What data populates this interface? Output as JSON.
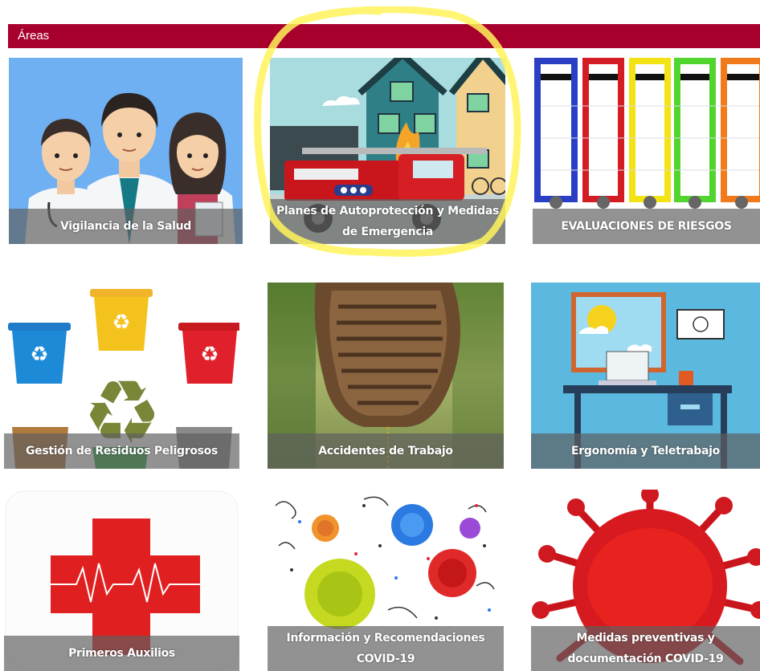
{
  "section": {
    "title": "Áreas"
  },
  "tiles": [
    {
      "label": "Vigilancia de la Salud",
      "icon": "doctors-illustration"
    },
    {
      "label": "Planes de Autoprotección y Medidas de Emergencia",
      "icon": "fire-truck-illustration"
    },
    {
      "label": "EVALUACIONES DE RIESGOS",
      "icon": "binders-illustration"
    },
    {
      "label": "Gestión de Residuos Peligrosos",
      "icon": "recycling-bins-illustration"
    },
    {
      "label": "Accidentes de Trabajo",
      "icon": "shoe-sole-photo"
    },
    {
      "label": "Ergonomía y Teletrabajo",
      "icon": "home-office-illustration"
    },
    {
      "label": "Primeros Auxilios",
      "icon": "first-aid-cross-illustration"
    },
    {
      "label": "Información y Recomendaciones COVID-19",
      "icon": "viruses-illustration"
    },
    {
      "label": "Medidas preventivas y documentación COVID-19",
      "icon": "coronavirus-illustration"
    }
  ],
  "colors": {
    "header": "#a8002d",
    "caption_overlay": "#5f5f5f",
    "highlight": "#fff35a"
  }
}
